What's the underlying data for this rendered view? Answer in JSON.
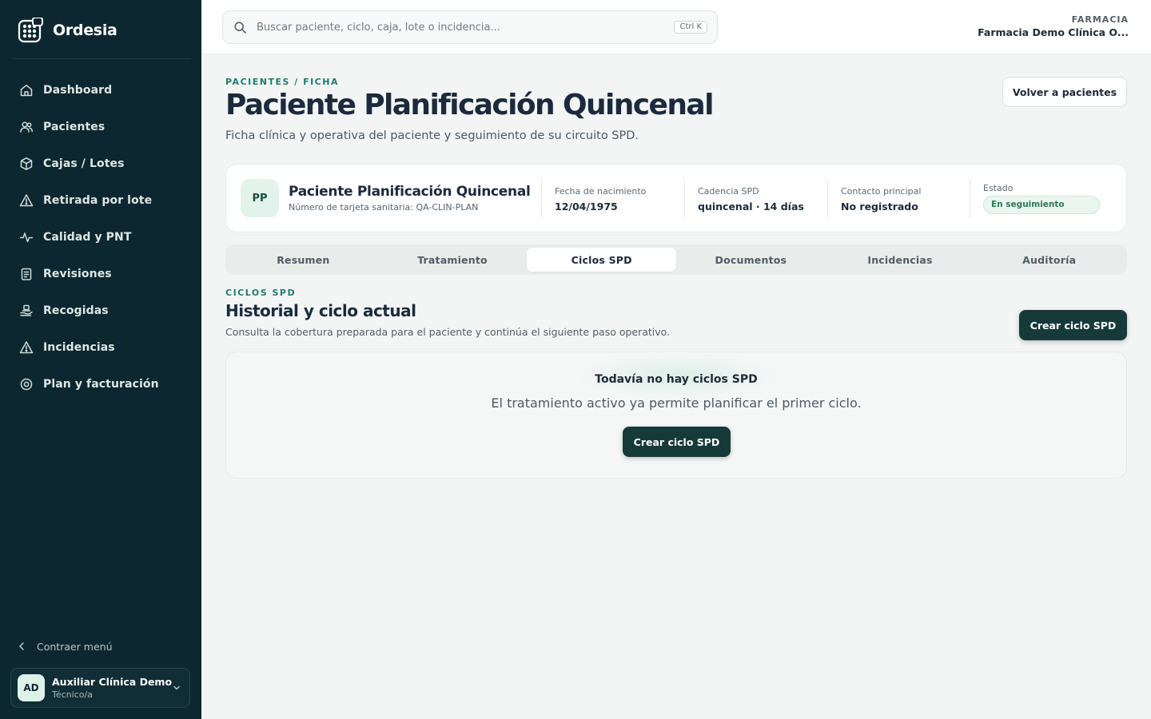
{
  "app": {
    "name": "Ordesia"
  },
  "sidebar": {
    "items": [
      {
        "label": "Dashboard",
        "icon": "home-icon"
      },
      {
        "label": "Pacientes",
        "icon": "users-icon"
      },
      {
        "label": "Cajas / Lotes",
        "icon": "box-icon"
      },
      {
        "label": "Retirada por lote",
        "icon": "warning-icon"
      },
      {
        "label": "Calidad y PNT",
        "icon": "activity-icon"
      },
      {
        "label": "Revisiones",
        "icon": "clipboard-icon"
      },
      {
        "label": "Recogidas",
        "icon": "hand-package-icon"
      },
      {
        "label": "Incidencias",
        "icon": "warning-icon"
      },
      {
        "label": "Plan y facturación",
        "icon": "settings-icon"
      }
    ],
    "collapse_label": "Contraer menú",
    "user": {
      "initials": "AD",
      "name": "Auxiliar Clínica Demo",
      "role": "Técnico/a"
    }
  },
  "topbar": {
    "search_placeholder": "Buscar paciente, ciclo, caja, lote o incidencia...",
    "search_value": "",
    "shortcut": "Ctrl K",
    "pharmacy_kicker": "FARMACIA",
    "pharmacy_name": "Farmacia Demo Clínica O..."
  },
  "page": {
    "breadcrumb": "PACIENTES / FICHA",
    "title": "Paciente Planificación Quincenal",
    "subtitle": "Ficha clínica y operativa del paciente y seguimiento de su circuito SPD.",
    "back_label": "Volver a pacientes"
  },
  "patient": {
    "initials": "PP",
    "name": "Paciente Planificación Quincenal",
    "card_number": "Número de tarjeta sanitaria: QA-CLIN-PLAN",
    "fields": [
      {
        "label": "Fecha de nacimiento",
        "value": "12/04/1975"
      },
      {
        "label": "Cadencia SPD",
        "value": "quincenal · 14 días"
      },
      {
        "label": "Contacto principal",
        "value": "No registrado"
      }
    ],
    "state_label": "Estado",
    "state_value": "En seguimiento"
  },
  "tabs": [
    {
      "label": "Resumen",
      "active": false
    },
    {
      "label": "Tratamiento",
      "active": false
    },
    {
      "label": "Ciclos SPD",
      "active": true
    },
    {
      "label": "Documentos",
      "active": false
    },
    {
      "label": "Incidencias",
      "active": false
    },
    {
      "label": "Auditoría",
      "active": false
    }
  ],
  "section": {
    "kicker": "CICLOS SPD",
    "title": "Historial y ciclo actual",
    "description": "Consulta la cobertura preparada para el paciente y continúa el siguiente paso operativo.",
    "create_label": "Crear ciclo SPD"
  },
  "empty_state": {
    "title": "Todavía no hay ciclos SPD",
    "text": "El tratamiento activo ya permite planificar el primer ciclo.",
    "button_label": "Crear ciclo SPD"
  },
  "colors": {
    "sidebar_bg": "#0d2730",
    "accent": "#1f7b6f",
    "primary_button": "#163a3a",
    "status_badge": "#2c7a53"
  }
}
